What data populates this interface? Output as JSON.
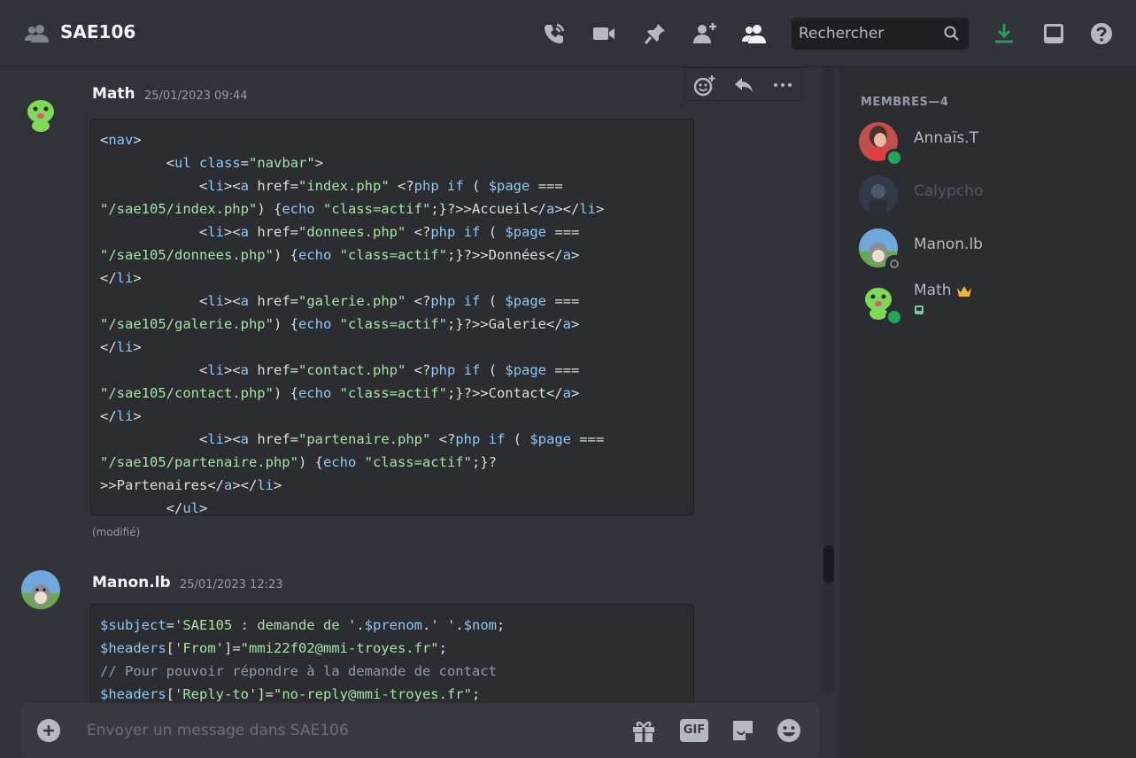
{
  "header": {
    "channel_name": "SAE106",
    "search_placeholder": "Rechercher"
  },
  "messages": [
    {
      "author": "Math",
      "timestamp": "25/01/2023 09:44",
      "code_lines": [
        "<nav>",
        "        <ul class=\"navbar\">",
        "            <li><a href=\"index.php\" <?php if ( $page ===",
        "\"/sae105/index.php\") {echo \"class=actif\";}?>>Accueil</a></li>",
        "            <li><a href=\"donnees.php\" <?php if ( $page ===",
        "\"/sae105/donnees.php\") {echo \"class=actif\";}?>>Données</a>",
        "</li>",
        "            <li><a href=\"galerie.php\" <?php if ( $page ===",
        "\"/sae105/galerie.php\") {echo \"class=actif\";}?>>Galerie</a>",
        "</li>",
        "            <li><a href=\"contact.php\" <?php if ( $page ===",
        "\"/sae105/contact.php\") {echo \"class=actif\";}?>>Contact</a>",
        "</li>",
        "            <li><a href=\"partenaire.php\" <?php if ( $page ===",
        "\"/sae105/partenaire.php\") {echo \"class=actif\";}?",
        ">>Partenaires</a></li>",
        "        </ul>"
      ],
      "edited_label": "(modifié)"
    },
    {
      "author": "Manon.lb",
      "timestamp": "25/01/2023 12:23",
      "code_lines": [
        "$subject='SAE105 : demande de '.$prenom.' '.$nom;",
        "$headers['From']=\"mmi22f02@mmi-troyes.fr\";",
        "// Pour pouvoir répondre à la demande de contact",
        "$headers['Reply-to']=\"no-reply@mmi-troyes.fr\";"
      ]
    }
  ],
  "composer": {
    "placeholder": "Envoyer un message dans SAE106",
    "gif_label": "GIF"
  },
  "members": {
    "header": "MEMBRES—4",
    "list": [
      {
        "name": "Annaïs.T",
        "status": "online"
      },
      {
        "name": "Calypcho",
        "status": "offline"
      },
      {
        "name": "Manon.lb",
        "status": "idle"
      },
      {
        "name": "Math",
        "status": "online",
        "badge": "crown-icon"
      }
    ]
  },
  "colors": {
    "online": "#23a55a",
    "download": "#23a55a",
    "crown": "#f0b232"
  }
}
